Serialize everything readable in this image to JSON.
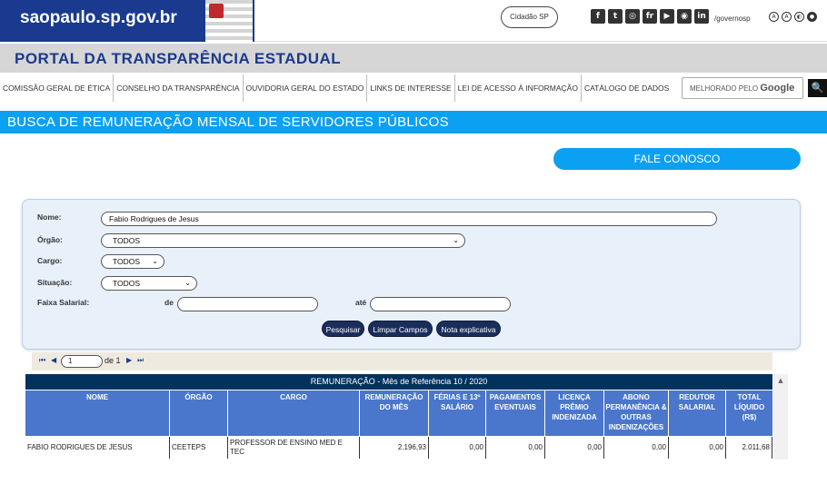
{
  "header": {
    "logo_text": "saopaulo.sp.gov.br",
    "cidadao_label": "Cidadão SP",
    "social_icons": [
      "facebook-icon",
      "twitter-icon",
      "instagram-icon",
      "flickr-icon",
      "youtube-icon",
      "issuu-icon",
      "linkedin-icon"
    ],
    "social_glyphs": [
      "f",
      "t",
      "◎",
      "fr",
      "▶",
      "◉",
      "in"
    ],
    "social_handle": "/governosp",
    "accessibility_icons": [
      "font-decrease-icon",
      "font-increase-icon",
      "contrast-icon",
      "dark-mode-icon"
    ],
    "accessibility_glyphs": [
      "A",
      "A",
      "◐",
      "●"
    ]
  },
  "portal": {
    "title": "PORTAL DA TRANSPARÊNCIA ESTADUAL"
  },
  "nav": {
    "items": [
      "COMISSÃO GERAL DE ÉTICA",
      "CONSELHO DA TRANSPARÊNCIA",
      "OUVIDORIA GERAL DO ESTADO",
      "LINKS DE INTERESSE",
      "LEI DE ACESSO À INFORMAÇÃO",
      "CATÁLOGO DE DADOS"
    ],
    "search_prefix": "MELHORADO PELO",
    "search_brand": "Google",
    "search_button": "🔍"
  },
  "section": {
    "title": "BUSCA DE REMUNERAÇÃO MENSAL DE SERVIDORES PÚBLICOS"
  },
  "contact": {
    "label": "FALE CONOSCO"
  },
  "form": {
    "nome_label": "Nome:",
    "nome_value": "Fabio Rodrigues de Jesus",
    "orgao_label": "Órgão:",
    "orgao_value": "TODOS",
    "cargo_label": "Cargo:",
    "cargo_value": "TODOS",
    "situacao_label": "Situação:",
    "situacao_value": "TODOS",
    "faixa_label": "Faixa Salarial:",
    "de_label": "de",
    "ate_label": "até",
    "de_value": "",
    "ate_value": "",
    "btn_pesquisar": "Pesquisar",
    "btn_limpar": "Limpar Campos",
    "btn_nota": "Nota explicativa"
  },
  "pager": {
    "first": "⏮",
    "prev": "◀",
    "page_value": "1",
    "of_text": "de 1",
    "next": "▶",
    "last": "⏭"
  },
  "table": {
    "caption": "REMUNERAÇÃO - Mês de Referência 10 / 2020",
    "headers": [
      "NOME",
      "ÓRGÃO",
      "CARGO",
      "REMUNERAÇÃO DO MÊS",
      "FÉRIAS E 13º SALÁRIO",
      "PAGAMENTOS EVENTUAIS",
      "LICENÇA PRÊMIO INDENIZADA",
      "ABONO PERMANÊNCIA & OUTRAS INDENIZAÇÕES",
      "REDUTOR SALARIAL",
      "TOTAL LÍQUIDO (R$)"
    ],
    "rows": [
      [
        "FABIO RODRIGUES DE JESUS",
        "CEETEPS",
        "PROFESSOR DE ENSINO MED E TEC",
        "2.196,93",
        "0,00",
        "0,00",
        "0,00",
        "0,00",
        "0,00",
        "2.011,68"
      ]
    ]
  }
}
